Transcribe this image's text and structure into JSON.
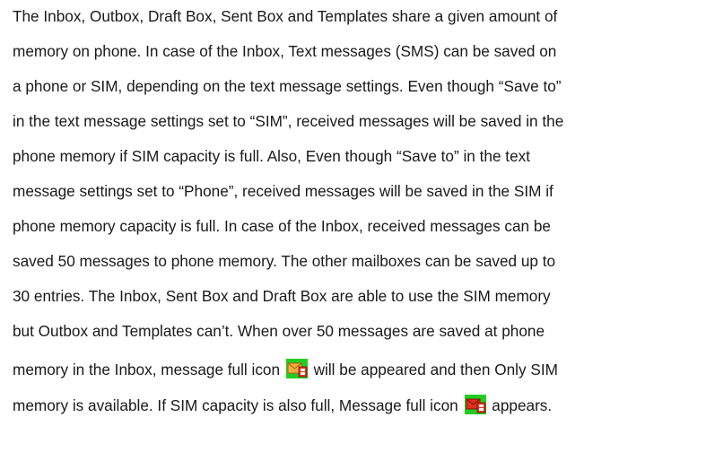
{
  "document": {
    "lines": [
      "The Inbox, Outbox, Draft Box, Sent Box and Templates share a given amount of",
      "memory on phone. In case of the Inbox, Text messages (SMS) can be saved on",
      "a phone or SIM, depending on the text message settings. Even though “Save to”",
      "in the text message settings set to “SIM”, received messages will be saved in the",
      "phone memory if SIM capacity is full. Also, Even though “Save to” in the text",
      "message settings set to “Phone”, received messages will be saved in the SIM if",
      "phone memory capacity is full. In case of the Inbox, received messages can be",
      "saved 50 messages to phone memory. The other mailboxes can be saved up to",
      "30 entries. The Inbox, Sent Box and Draft Box are able to use the SIM memory",
      "but Outbox and Templates can’t. When over 50 messages are saved at phone"
    ],
    "line11_before": "memory in the Inbox, message full icon",
    "line11_after": "will be appeared and then Only SIM",
    "line12_before": "memory is available. If SIM capacity is also full, Message full icon",
    "line12_after": "appears."
  },
  "icons": {
    "phone_full": "message-full-phone-icon",
    "sim_full": "message-full-sim-icon"
  },
  "colors": {
    "text": "#1a1a1a",
    "phone_icon_bg": "#22cc22",
    "sim_icon_bg": "#22cc22",
    "envelope": "#e8a030",
    "badge": "#e03020"
  }
}
